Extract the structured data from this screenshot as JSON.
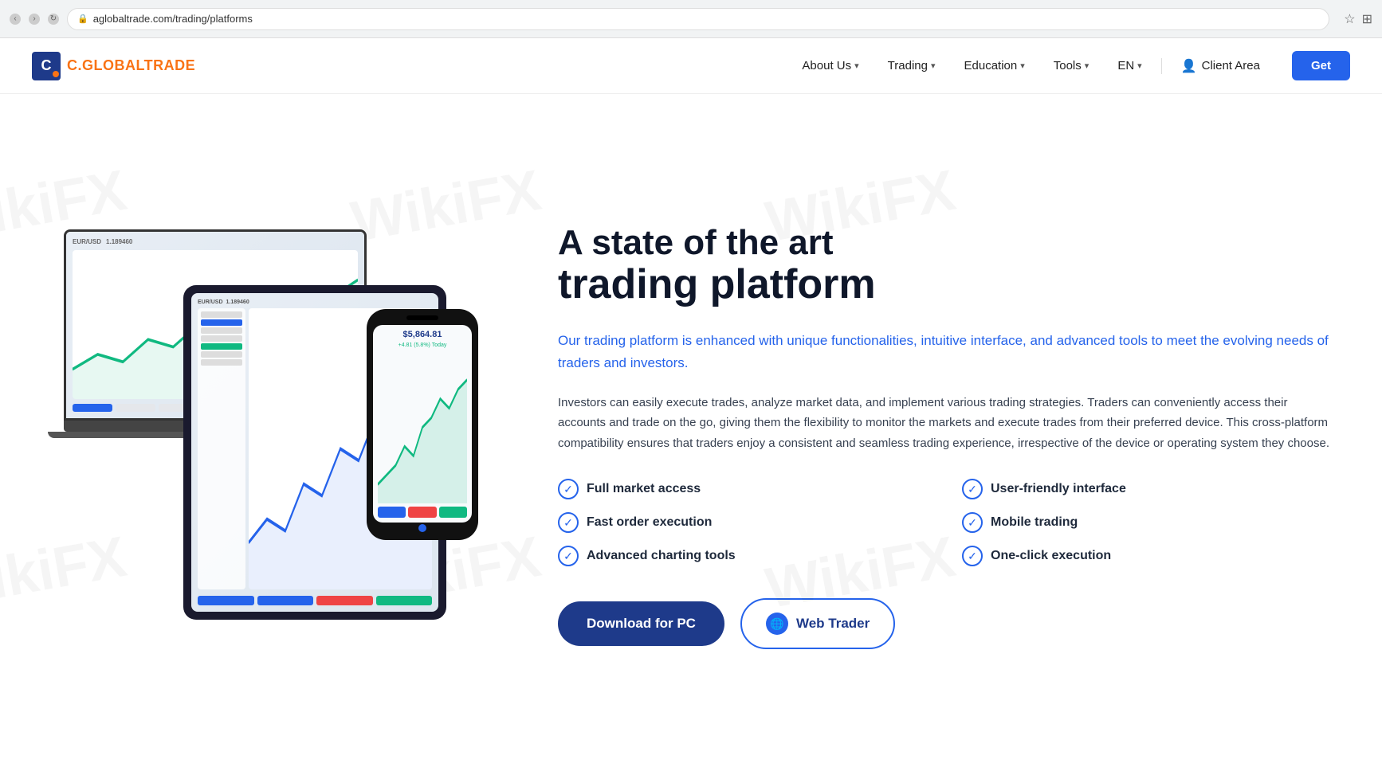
{
  "browser": {
    "url": "aglobaltrade.com/trading/platforms",
    "back_title": "back",
    "forward_title": "forward",
    "refresh_title": "refresh"
  },
  "navbar": {
    "logo_text": "GLOBALTRADE",
    "logo_c": "C.",
    "menu_items": [
      {
        "label": "About Us",
        "has_dropdown": true
      },
      {
        "label": "Trading",
        "has_dropdown": true
      },
      {
        "label": "Education",
        "has_dropdown": true
      },
      {
        "label": "Tools",
        "has_dropdown": true
      },
      {
        "label": "EN",
        "has_dropdown": true
      }
    ],
    "client_area_label": "Client Area",
    "get_btn_label": "Get"
  },
  "hero": {
    "heading_line1": "A state of the art",
    "heading_line2": "trading platform",
    "lead": "Our trading platform is enhanced with unique functionalities, intuitive interface, and advanced tools to meet the evolving needs of traders and investors.",
    "body": "Investors can easily execute trades, analyze market data, and implement various trading strategies. Traders can conveniently access their accounts and trade on the go, giving them the flexibility to monitor the markets and execute trades from their preferred device. This cross-platform compatibility ensures that traders enjoy a consistent and seamless trading experience, irrespective of the device or operating system they choose.",
    "features": [
      {
        "label": "Full market access"
      },
      {
        "label": "User-friendly interface"
      },
      {
        "label": "Fast order execution"
      },
      {
        "label": "Mobile trading"
      },
      {
        "label": "Advanced charting tools"
      },
      {
        "label": "One-click execution"
      }
    ],
    "cta_primary": "Download for PC",
    "cta_secondary": "Web Trader",
    "chart_pair": "EUR/USD",
    "chart_price": "1.189460",
    "phone_price": "$5,864.81",
    "phone_change": "+4.81 (5.8%) Today"
  },
  "watermark": {
    "text": "WikiFX"
  }
}
